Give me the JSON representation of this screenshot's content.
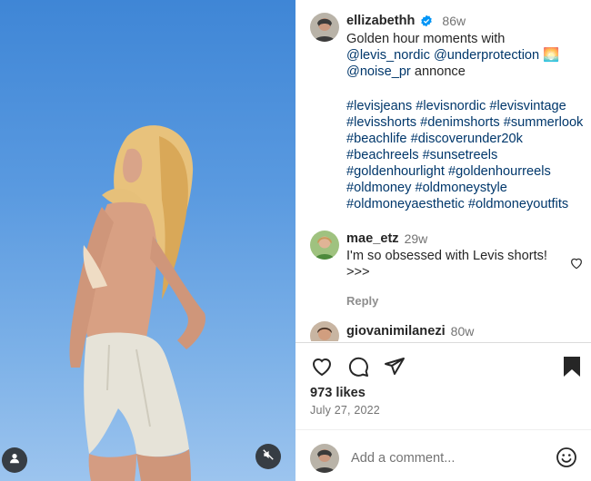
{
  "post": {
    "author": "ellizabethh",
    "time": "86w",
    "caption_lines": [
      {
        "parts": [
          {
            "text": "Golden hour moments with",
            "kind": "text"
          }
        ]
      },
      {
        "parts": [
          {
            "text": "@levis_nordic",
            "kind": "mention"
          },
          {
            "text": " ",
            "kind": "text"
          },
          {
            "text": "@underprotection",
            "kind": "mention"
          },
          {
            "text": " 🌅",
            "kind": "text"
          }
        ]
      },
      {
        "parts": [
          {
            "text": "@noise_pr",
            "kind": "mention"
          },
          {
            "text": " annonce",
            "kind": "text"
          }
        ]
      }
    ],
    "hashtag_lines": [
      "#levisjeans #levisnordic #levisvintage",
      "#levisshorts #denimshorts #summerlook",
      "#beachlife #discoverunder20k",
      "#beachreels #sunsetreels",
      "#goldenhourlight #goldenhourreels",
      "#oldmoney #oldmoneystyle",
      "#oldmoneyaesthetic #oldmoneyoutfits"
    ],
    "likes": "973 likes",
    "date": "July 27, 2022"
  },
  "comments": [
    {
      "username": "mae_etz",
      "time": "29w",
      "text_lines": [
        "I'm so obsessed with Levis shorts!",
        ">>>"
      ],
      "reply_label": "Reply"
    },
    {
      "username": "giovanimilanezi",
      "time": "80w"
    }
  ],
  "composer": {
    "placeholder": "Add a comment..."
  },
  "icons": {
    "like": "heart-icon",
    "comment": "comment-bubble-icon",
    "share": "paper-plane-icon",
    "save": "bookmark-icon",
    "emoji": "emoji-icon",
    "mute": "muted-speaker-icon",
    "tag": "user-tag-icon"
  },
  "colors": {
    "link": "#00376b",
    "verified": "#0095f6",
    "muted_text": "#737373"
  }
}
